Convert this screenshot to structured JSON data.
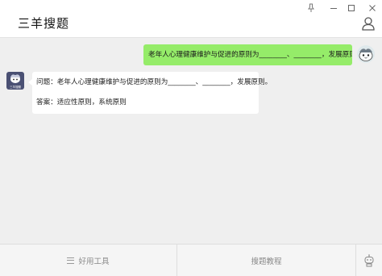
{
  "app": {
    "title": "三羊搜题"
  },
  "window_controls": {
    "pin_icon": "pin-icon",
    "minimize_icon": "minimize-icon",
    "maximize_icon": "maximize-icon",
    "close_icon": "close-icon"
  },
  "header": {
    "user_icon": "user-icon"
  },
  "chat": {
    "user_message": "老年人心理健康维护与促进的原则为________、________，发展原则。",
    "bot_avatar_label": "三羊搜题",
    "bot_question": "问题：老年人心理健康维护与促进的原则为________、________，发展原则。",
    "bot_answer": "答案：适应性原则，系统原则"
  },
  "toolbar": {
    "tools_label": "好用工具",
    "tutorial_label": "搜题教程",
    "robot_icon": "robot-icon",
    "menu_icon": "menu-icon"
  },
  "colors": {
    "user_bubble": "#95ec69",
    "bot_bubble": "#ffffff",
    "background": "#efefef",
    "titlebar": "#ffffff",
    "bot_avatar": "#4a5073"
  }
}
